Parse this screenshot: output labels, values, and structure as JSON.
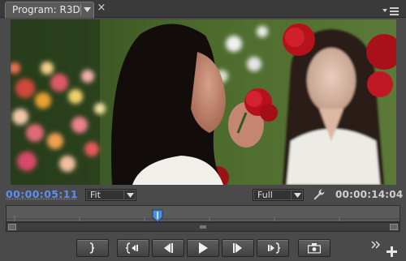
{
  "panel": {
    "tab_label": "Program: R3D",
    "close_glyph": "×"
  },
  "controls": {
    "current_timecode": "00:00:05:11",
    "zoom_select": "Fit",
    "quality_select": "Full",
    "duration_timecode": "00:00:14:04"
  },
  "timeline": {
    "playhead_fraction": 0.385
  },
  "transport": [
    {
      "name": "mark-out-button",
      "icon": "mark-out-icon"
    },
    {
      "name": "go-to-previous-edit-button",
      "icon": "previous-edit-icon"
    },
    {
      "name": "step-back-button",
      "icon": "step-back-icon"
    },
    {
      "name": "play-button",
      "icon": "play-icon"
    },
    {
      "name": "step-forward-button",
      "icon": "step-forward-icon"
    },
    {
      "name": "go-to-next-edit-button",
      "icon": "next-edit-icon"
    },
    {
      "name": "export-frame-button",
      "icon": "export-frame-icon"
    }
  ],
  "colors": {
    "timecode_current": "#5f8df0",
    "playhead": "#4a8fd8",
    "panel_bg": "#4a4a4a"
  }
}
